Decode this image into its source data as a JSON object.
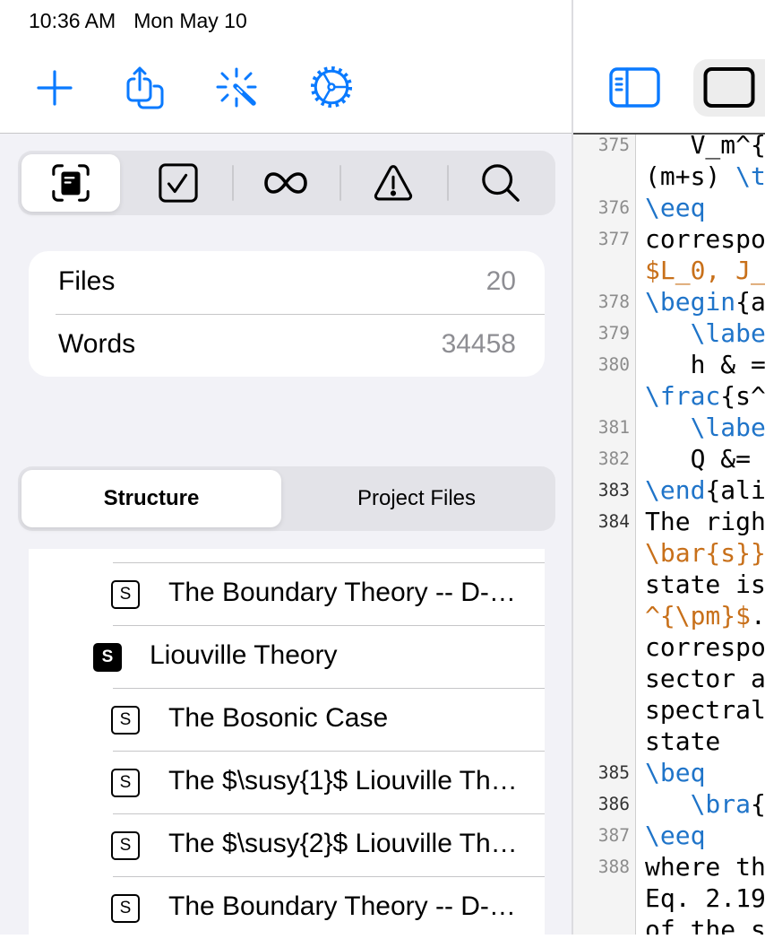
{
  "status_bar": {
    "time": "10:36 AM",
    "date": "Mon May 10"
  },
  "toolbar": {
    "accent_color": "#0A7AFF",
    "buttons": [
      {
        "icon": "plus-icon"
      },
      {
        "icon": "share-icon"
      },
      {
        "icon": "magic-wand-icon"
      },
      {
        "icon": "settings-gear-icon"
      }
    ]
  },
  "sidebar_tabs": [
    {
      "icon": "doc-viewfinder-icon",
      "selected": true
    },
    {
      "icon": "checkmark-square-icon",
      "selected": false
    },
    {
      "icon": "infinity-icon",
      "selected": false
    },
    {
      "icon": "warning-triangle-icon",
      "selected": false
    },
    {
      "icon": "magnifying-glass-icon",
      "selected": false
    }
  ],
  "stats": [
    {
      "label": "Files",
      "value": "20"
    },
    {
      "label": "Words",
      "value": "34458"
    }
  ],
  "view_switcher": {
    "options": [
      {
        "label": "Structure",
        "selected": true
      },
      {
        "label": "Project Files",
        "selected": false
      }
    ]
  },
  "outline": {
    "items": [
      {
        "level": 2,
        "badge": "S",
        "badge_style": "outline",
        "title": "The Boundary Theory -- D-…"
      },
      {
        "level": 1,
        "badge": "S",
        "badge_style": "filled",
        "title": "Liouville Theory"
      },
      {
        "level": 2,
        "badge": "S",
        "badge_style": "outline",
        "title": "The Bosonic Case"
      },
      {
        "level": 2,
        "badge": "S",
        "badge_style": "outline",
        "title": "The $\\susy{1}$ Liouville Th…"
      },
      {
        "level": 2,
        "badge": "S",
        "badge_style": "outline",
        "title": "The $\\susy{2}$ Liouville Th…"
      },
      {
        "level": 2,
        "badge": "S",
        "badge_style": "outline",
        "title": "The Boundary Theory -- D-…"
      }
    ]
  },
  "editor_header": {
    "buttons": [
      {
        "icon": "sidebar-left-icon",
        "active": true
      },
      {
        "icon": "rectangle-icon",
        "selected": true
      }
    ]
  },
  "editor": {
    "syntax_colors": {
      "text": "#000000",
      "command": "#1F74C9",
      "math": "#C8701A"
    },
    "lines": [
      {
        "number": "375",
        "active": false,
        "segments": [
          {
            "text": "   V_m^{",
            "kind": "text"
          }
        ]
      },
      {
        "number": "",
        "active": false,
        "segments": [
          {
            "text": "(m+s) ",
            "kind": "text"
          },
          {
            "text": "\\t",
            "kind": "command"
          }
        ]
      },
      {
        "number": "376",
        "active": false,
        "segments": [
          {
            "text": "\\eeq",
            "kind": "command"
          }
        ]
      },
      {
        "number": "377",
        "active": false,
        "segments": [
          {
            "text": "correspo",
            "kind": "text"
          }
        ]
      },
      {
        "number": "",
        "active": false,
        "segments": [
          {
            "text": "$L_0, J_",
            "kind": "math"
          }
        ]
      },
      {
        "number": "378",
        "active": false,
        "segments": [
          {
            "text": "\\begin",
            "kind": "command"
          },
          {
            "text": "{a",
            "kind": "text"
          }
        ]
      },
      {
        "number": "379",
        "active": false,
        "segments": [
          {
            "text": "   \\labe",
            "kind": "command"
          }
        ]
      },
      {
        "number": "380",
        "active": false,
        "segments": [
          {
            "text": "   h & =",
            "kind": "text"
          }
        ]
      },
      {
        "number": "",
        "active": false,
        "segments": [
          {
            "text": "\\frac",
            "kind": "command"
          },
          {
            "text": "{s^",
            "kind": "text"
          }
        ]
      },
      {
        "number": "381",
        "active": false,
        "segments": [
          {
            "text": "   \\labe",
            "kind": "command"
          }
        ]
      },
      {
        "number": "382",
        "active": false,
        "segments": [
          {
            "text": "   Q &=",
            "kind": "text"
          }
        ]
      },
      {
        "number": "383",
        "active": true,
        "segments": [
          {
            "text": "\\end",
            "kind": "command"
          },
          {
            "text": "{ali",
            "kind": "text"
          }
        ]
      },
      {
        "number": "384",
        "active": true,
        "segments": [
          {
            "text": "The righ",
            "kind": "text"
          }
        ]
      },
      {
        "number": "",
        "active": true,
        "segments": [
          {
            "text": "\\bar{s}}",
            "kind": "math"
          }
        ]
      },
      {
        "number": "",
        "active": true,
        "segments": [
          {
            "text": "state is",
            "kind": "text"
          }
        ]
      },
      {
        "number": "",
        "active": true,
        "segments": [
          {
            "text": "^{\\pm}$",
            "kind": "math"
          },
          {
            "text": ".",
            "kind": "text"
          }
        ]
      },
      {
        "number": "",
        "active": true,
        "segments": [
          {
            "text": "correspo",
            "kind": "text"
          }
        ]
      },
      {
        "number": "",
        "active": true,
        "segments": [
          {
            "text": "sector a",
            "kind": "text"
          }
        ]
      },
      {
        "number": "",
        "active": true,
        "segments": [
          {
            "text": "spectral",
            "kind": "text"
          }
        ]
      },
      {
        "number": "",
        "active": true,
        "segments": [
          {
            "text": "state",
            "kind": "text"
          }
        ]
      },
      {
        "number": "385",
        "active": true,
        "segments": [
          {
            "text": "\\beq",
            "kind": "command"
          }
        ]
      },
      {
        "number": "386",
        "active": true,
        "segments": [
          {
            "text": "   \\bra",
            "kind": "command"
          },
          {
            "text": "{",
            "kind": "text"
          }
        ]
      },
      {
        "number": "387",
        "active": false,
        "segments": [
          {
            "text": "\\eeq",
            "kind": "command"
          }
        ]
      },
      {
        "number": "388",
        "active": false,
        "segments": [
          {
            "text": "where th",
            "kind": "text"
          }
        ]
      },
      {
        "number": "",
        "active": false,
        "segments": [
          {
            "text": "Eq. 2.19",
            "kind": "text"
          }
        ]
      },
      {
        "number": "",
        "active": false,
        "segments": [
          {
            "text": "of the s",
            "kind": "text"
          }
        ]
      }
    ]
  }
}
